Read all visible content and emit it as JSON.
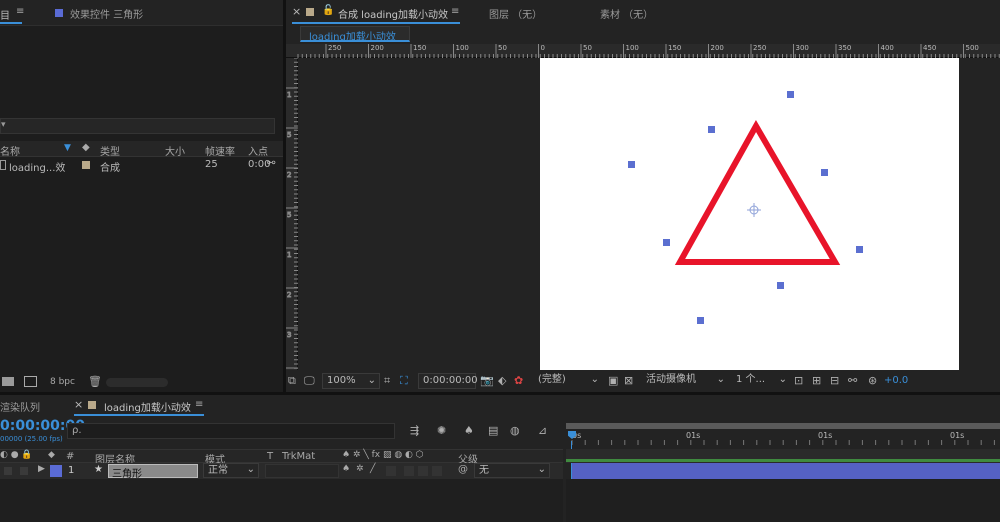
{
  "project_panel": {
    "menu_icon": "≡",
    "effects_tab": "效果控件 三角形",
    "headers": [
      "名称",
      "类型",
      "大小",
      "帧速率",
      "入点"
    ],
    "item": {
      "name": "loading...效",
      "type": "合成",
      "fps": "25",
      "in": "0:00"
    },
    "bpc": "8 bpc"
  },
  "comp_panel": {
    "tab_label": "合成 loading加载小动效",
    "tab_menu": "≡",
    "layer_tab": "图层 （无）",
    "footage_tab": "素材 （无）",
    "breadcrumb": "loading加载小动效",
    "ruler_labels": [
      "250",
      "200",
      "150",
      "100",
      "50",
      "0",
      "50",
      "100",
      "150",
      "200",
      "250",
      "300",
      "350",
      "400",
      "450",
      "500"
    ],
    "ruler_v_labels": [
      "1",
      "5",
      "2",
      "5",
      "1",
      "2",
      "3",
      "4"
    ],
    "toolbar": {
      "zoom": "100%",
      "timecode": "0:00:00:00",
      "resolution": "(完整)",
      "camera": "活动摄像机",
      "views": "1 个...",
      "exposure": "+0.0"
    }
  },
  "timeline": {
    "tab_render": "渲染队列",
    "tab_comp": "loading加载小动效",
    "tab_menu": "≡",
    "timecode": "0:00:00:00",
    "fps_note": "00000 (25.00 fps)",
    "search_placeholder": "ρ.",
    "columns": {
      "num": "#",
      "layer_name": "图层名称",
      "mode": "模式",
      "t": "T",
      "trkmat": "TrkMat",
      "parent": "父级"
    },
    "layer": {
      "num": "1",
      "name": "三角形",
      "mode": "正常",
      "parent": "无"
    },
    "ruler": [
      "0s",
      "01s",
      "01s",
      "01s"
    ]
  },
  "colors": {
    "accent": "#3a8fd8",
    "shape_stroke": "#e8142a",
    "layer_bar": "#5561c4",
    "handle": "#5b6fd0"
  }
}
